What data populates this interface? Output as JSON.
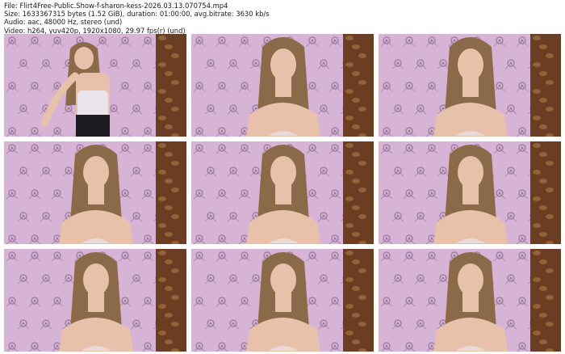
{
  "header": {
    "file": "File: Flirt4Free-Public.Show-f-sharon-kess-2026.03.13.070754.mp4",
    "size": "Size: 1633367315 bytes (1.52 GiB), duration: 01:00:00, avg.bitrate: 3630 kb/s",
    "audio": "Audio: aac, 48000 Hz, stereo (und)",
    "video": "Video: h264, yuv420p, 1920x1080, 29.97 fps(r) (und)"
  },
  "thumbnails": [
    {
      "pose": "standing"
    },
    {
      "pose": "seated"
    },
    {
      "pose": "seated"
    },
    {
      "pose": "seated"
    },
    {
      "pose": "seated"
    },
    {
      "pose": "seated"
    },
    {
      "pose": "seated"
    },
    {
      "pose": "seated"
    },
    {
      "pose": "seated"
    }
  ],
  "colors": {
    "wall": "#d7b3d6",
    "pattern": "#8a6f8e",
    "curtain": "#6b3d22",
    "hair": "#8a6a48",
    "skin": "#e8c1ab",
    "top": "#e9e4ea",
    "pants": "#1d1b1f"
  }
}
